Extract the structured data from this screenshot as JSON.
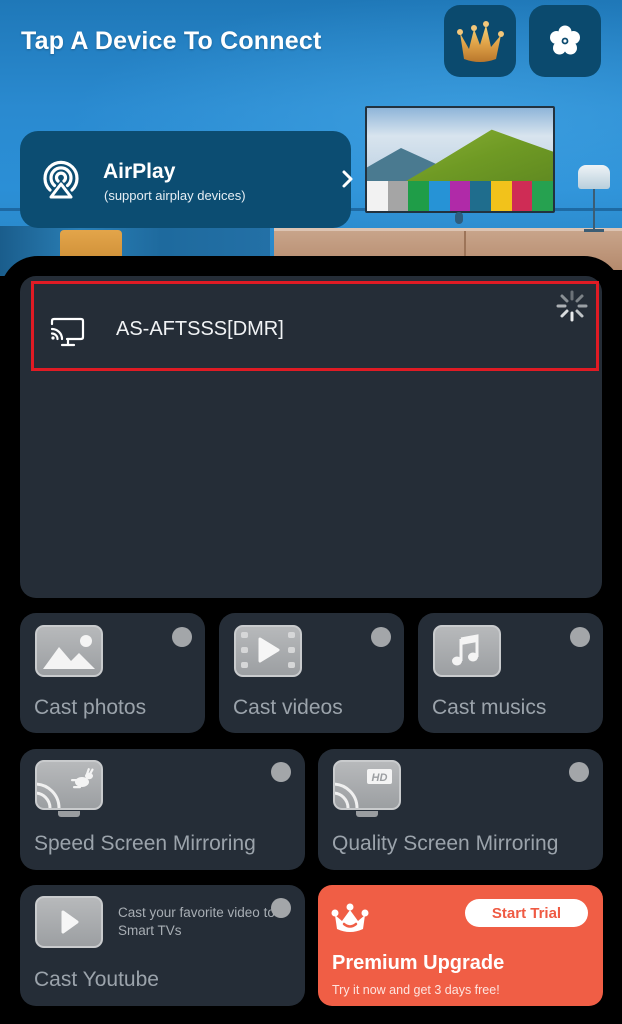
{
  "header": {
    "title": "Tap A Device To Connect",
    "crown_icon": "crown-icon",
    "settings_icon": "gear-icon"
  },
  "airplay": {
    "title": "AirPlay",
    "subtitle": "(support airplay devices)",
    "icon": "airplay-icon",
    "chevron": "chevron-right-icon"
  },
  "devices": {
    "items": [
      {
        "name": "AS-AFTSSS[DMR]",
        "icon": "cast-screen-icon",
        "highlighted": true
      }
    ],
    "loading_icon": "spinner-icon"
  },
  "tiles": [
    {
      "id": "cast-photos",
      "label": "Cast photos",
      "icon": "photo-icon"
    },
    {
      "id": "cast-videos",
      "label": "Cast videos",
      "icon": "video-icon"
    },
    {
      "id": "cast-musics",
      "label": "Cast musics",
      "icon": "music-icon"
    },
    {
      "id": "speed-screen-mirroring",
      "label": "Speed Screen Mirroring",
      "icon": "speed-mirror-icon"
    },
    {
      "id": "quality-screen-mirroring",
      "label": "Quality Screen Mirroring",
      "icon": "hd-mirror-icon",
      "badge": "HD"
    },
    {
      "id": "cast-youtube",
      "label": "Cast Youtube",
      "icon": "youtube-play-icon",
      "sub": "Cast your favorite video to Smart TVs"
    }
  ],
  "premium": {
    "title": "Premium Upgrade",
    "subtitle": "Try it now and get 3 days free!",
    "button": "Start Trial",
    "icon": "crown-icon"
  },
  "colors": {
    "highlight_border": "#e01b24",
    "premium_bg": "#f05e45",
    "card_bg": "#252d37",
    "header_btn_bg": "#0b4a6e"
  }
}
